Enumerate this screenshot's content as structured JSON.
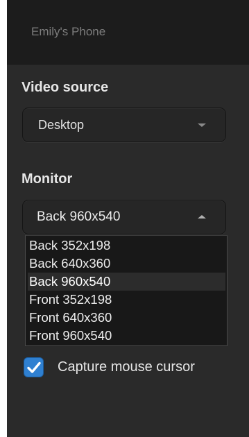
{
  "header": {
    "title": "Emily's Phone"
  },
  "video_source": {
    "label": "Video source",
    "selected": "Desktop"
  },
  "monitor": {
    "label": "Monitor",
    "selected": "Back 960x540",
    "options": [
      "Back 352x198",
      "Back 640x360",
      "Back 960x540",
      "Front 352x198",
      "Front 640x360",
      "Front 960x540"
    ]
  },
  "capture_cursor": {
    "label": "Capture mouse cursor",
    "checked": true
  },
  "colors": {
    "panel_background": "#2a2a2a",
    "header_background": "#1c1c1c",
    "checkbox_accent": "#2f80d1"
  }
}
